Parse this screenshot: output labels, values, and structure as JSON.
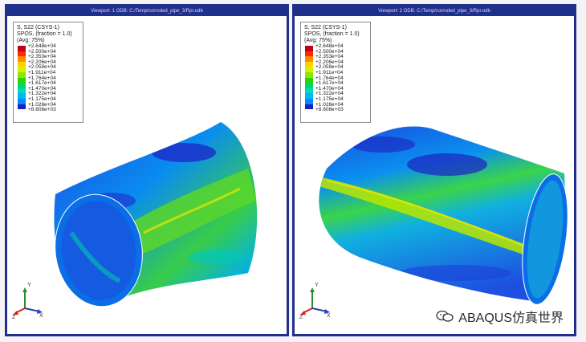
{
  "viewports": [
    {
      "title": "Viewport: 1   ODB: C:/Temp/corroded_pipe_3/Rpr.odb",
      "legend": {
        "line1": "S, S22 (CSYS-1)",
        "line2": "SPOS, (fraction = 1.0)",
        "line3": "(Avg: 75%)",
        "values": [
          "+2.648e+04",
          "+2.500e+04",
          "+2.353e+04",
          "+2.206e+04",
          "+2.059e+04",
          "+1.911e+04",
          "+1.764e+04",
          "+1.617e+04",
          "+1.470e+04",
          "+1.322e+04",
          "+1.175e+04",
          "+1.028e+04",
          "+8.808e+03"
        ]
      },
      "triad": {
        "x": "X",
        "y": "Y",
        "z": "Z"
      }
    },
    {
      "title": "Viewport: 2   ODB: C:/Temp/corroded_pipe_3/Rpr.odb",
      "legend": {
        "line1": "S, S22 (CSYS-1)",
        "line2": "SPOS, (fraction = 1.0)",
        "line3": "(Avg: 75%)",
        "values": [
          "+2.648e+04",
          "+2.500e+04",
          "+2.353e+04",
          "+2.206e+04",
          "+2.059e+04",
          "+1.911e+04",
          "+1.764e+04",
          "+1.617e+04",
          "+1.470e+04",
          "+1.322e+04",
          "+1.175e+04",
          "+1.028e+04",
          "+8.808e+03"
        ]
      },
      "triad": {
        "x": "X",
        "y": "Y",
        "z": "Z"
      }
    }
  ],
  "legend_colors": [
    "#c0001a",
    "#ff2a00",
    "#ff8c00",
    "#ffd000",
    "#d9ef00",
    "#8ee600",
    "#2fd400",
    "#00d66a",
    "#00d8c0",
    "#00b8f0",
    "#008cf6",
    "#1b52e8",
    "#1d1ec8"
  ],
  "watermark": {
    "text": "ABAQUS仿真世界"
  }
}
